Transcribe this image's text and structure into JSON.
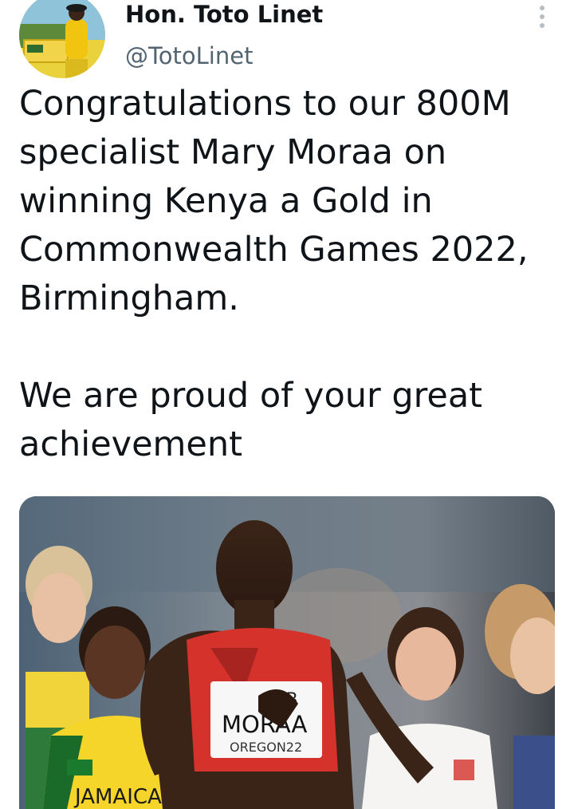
{
  "author": {
    "name": "Hon. Toto Linet",
    "handle": "@TotoLinet",
    "avatar_icon": "profile-photo-avatar"
  },
  "menu": {
    "icon": "more-vertical-icon"
  },
  "tweet": {
    "text_line1": "Congratulations to our 800M specialist Mary Moraa on winning Kenya a Gold in Commonwealth Games 2022, Birmingham.",
    "text_line2": "We are proud of your great achievement"
  },
  "media": {
    "bib_top": "NB",
    "bib_name": "MORAA",
    "bib_event": "OREGON22",
    "left_jersey_text": "JAMAICA"
  },
  "colors": {
    "accent": "#f4d21f",
    "handle_gray": "#536471",
    "jersey_red": "#d4322b"
  }
}
